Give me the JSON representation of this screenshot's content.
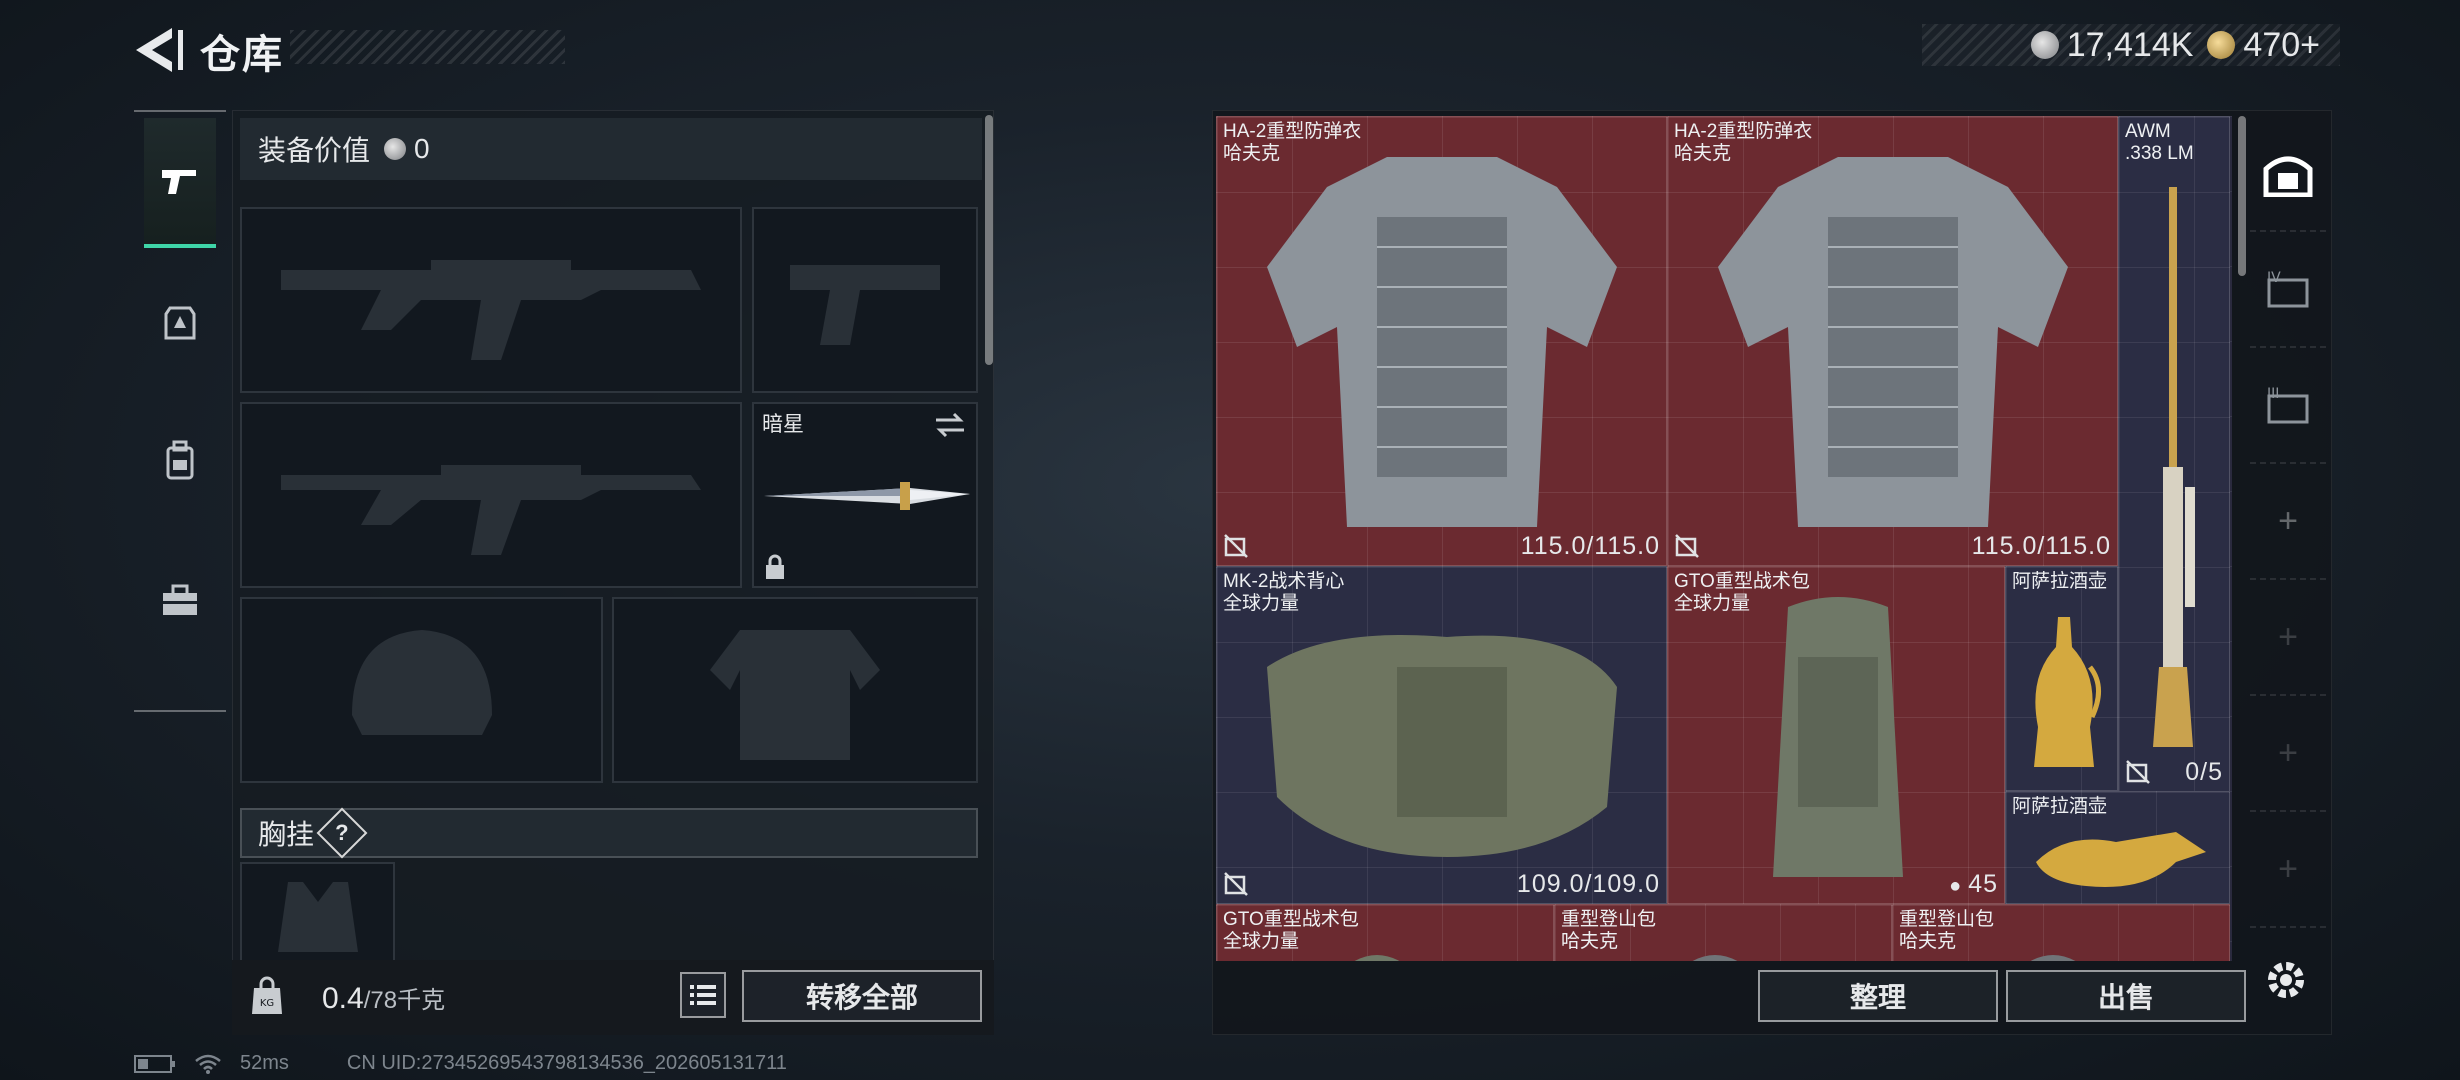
{
  "header": {
    "title": "仓库"
  },
  "currency": [
    {
      "icon": "silver-coin-icon",
      "value": "17,414K"
    },
    {
      "icon": "gold-coin-icon",
      "value": "470+"
    }
  ],
  "left_tabs": [
    "pistol-icon",
    "armor-crate-icon",
    "backpack-icon",
    "toolbox-icon"
  ],
  "equipment": {
    "value_label": "装备价值",
    "value": "0",
    "melee_slot": {
      "label": "暗星"
    },
    "chest_rig_label": "胸挂",
    "chest_rig_help": "?"
  },
  "bottom_left": {
    "weight_current": "0.4",
    "weight_max": "/78千克",
    "transfer_all": "转移全部"
  },
  "storage": {
    "items": [
      {
        "name": "HA-2重型防弹衣",
        "brand": "哈夫克",
        "durability": "115.0/115.0"
      },
      {
        "name": "HA-2重型防弹衣",
        "brand": "哈夫克",
        "durability": "115.0/115.0"
      },
      {
        "name": "AWM",
        "brand": ".338 LM",
        "ammo": "0/5"
      },
      {
        "name": "MK-2战术背心",
        "brand": "全球力量",
        "durability": "109.0/109.0"
      },
      {
        "name": "GTO重型战术包",
        "brand": "全球力量",
        "count": "45"
      },
      {
        "name": "阿萨拉酒壶"
      },
      {
        "name": "阿萨拉酒壶"
      },
      {
        "name": "GTO重型战术包",
        "brand": "全球力量"
      },
      {
        "name": "重型登山包",
        "brand": "哈夫克"
      },
      {
        "name": "重型登山包",
        "brand": "哈夫克"
      }
    ],
    "sort_button": "整理",
    "sell_button": "出售"
  },
  "status_bar": {
    "ping": "52ms",
    "uid": "CN UID:27345269543798134536_202605131711"
  }
}
